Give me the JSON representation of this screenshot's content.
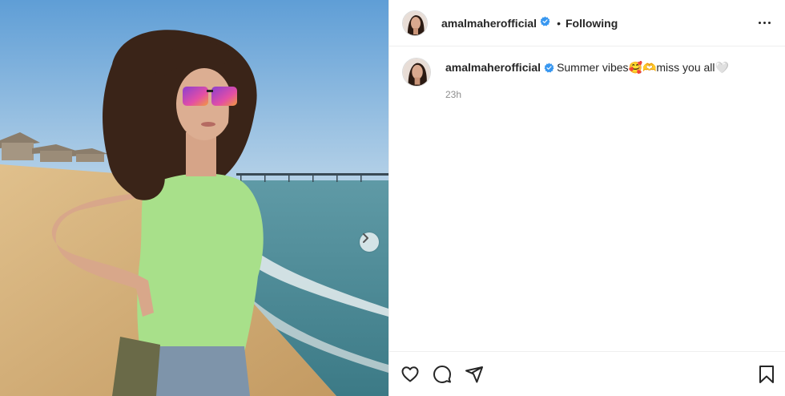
{
  "post": {
    "author": {
      "username": "amalmaherofficial",
      "verified": true,
      "avatar_icon": "profile-avatar"
    },
    "follow_separator": "•",
    "follow_state": "Following",
    "caption": "Summer vibes🥰🫶miss you all🤍",
    "timestamp": "23h",
    "media": {
      "alt_icon": "beach-photo",
      "carousel_next_icon": "chevron-right-icon"
    },
    "actions": {
      "like_icon": "heart-icon",
      "comment_icon": "comment-icon",
      "share_icon": "paper-plane-icon",
      "save_icon": "bookmark-icon"
    }
  },
  "colors": {
    "text": "#262626",
    "muted": "#8e8e8e",
    "verified": "#3897f0",
    "divider": "#efefef"
  }
}
